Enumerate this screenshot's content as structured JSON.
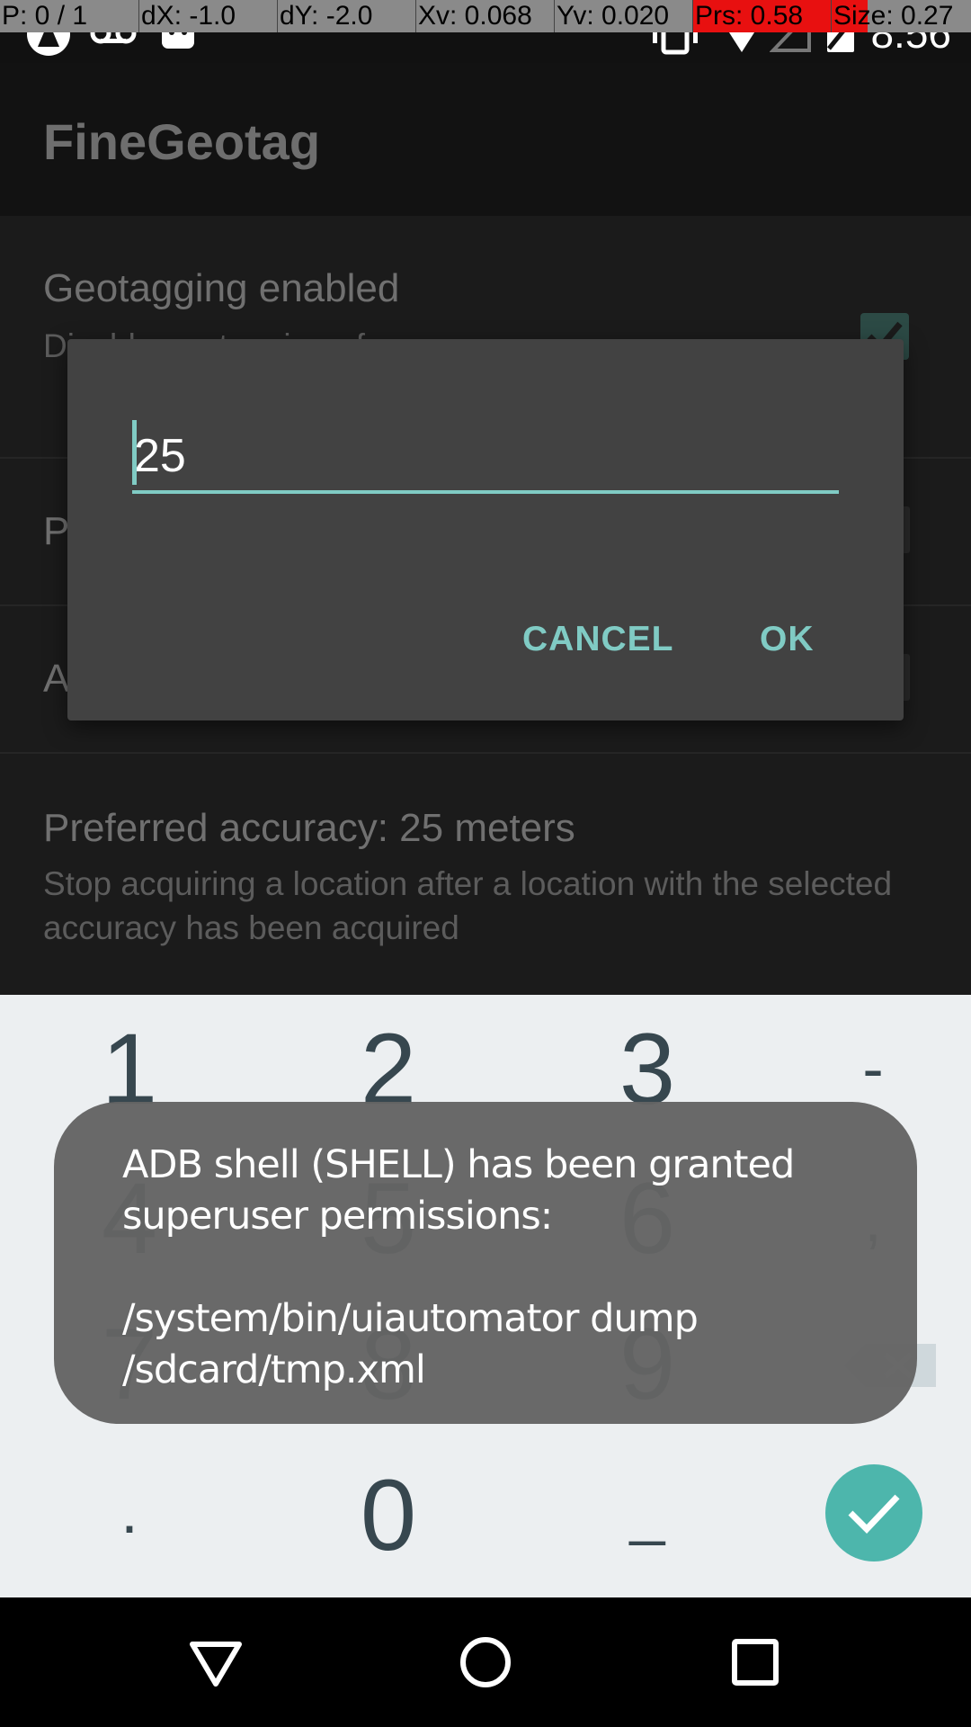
{
  "pointer_overlay": {
    "p": "P: 0 / 1",
    "dx": "dX: -1.0",
    "dy": "dY: -2.0",
    "xv": "Xv: 0.068",
    "yv": "Yv: 0.020",
    "prs": "Prs: 0.58",
    "size": "Size: 0.27"
  },
  "status_bar": {
    "time": "8:56",
    "icons": [
      "app-notification-icon",
      "voicemail-icon",
      "android-icon",
      "vibrate-icon",
      "wifi-icon",
      "signal-icon",
      "battery-icon"
    ]
  },
  "app": {
    "title": "FineGeotag",
    "prefs": [
      {
        "title": "Geotagging enabled",
        "summary": "Disable geotagging of your camera ap",
        "checked": true
      },
      {
        "title": "P"
      },
      {
        "title": "A"
      },
      {
        "title": "Preferred accuracy: 25 meters",
        "summary": "Stop acquiring a location after a location with the selected accuracy has been acquired"
      }
    ]
  },
  "dialog": {
    "input_value": "25",
    "cancel_label": "CANCEL",
    "ok_label": "OK",
    "accent_color": "#80cbc4"
  },
  "keyboard": {
    "row1": [
      "1",
      "2",
      "3",
      "-"
    ],
    "row2": [
      "4",
      "5",
      "6",
      ","
    ],
    "row3": [
      "7",
      "8",
      "9"
    ],
    "row4": [
      ".",
      "0",
      "_"
    ],
    "delete_icon": "backspace-icon",
    "done_icon": "check-icon",
    "done_color": "#4db6ac"
  },
  "toast": {
    "message": "ADB shell (SHELL) has been granted superuser permissions:\n\n/system/bin/uiautomator dump /sdcard/tmp.xml"
  },
  "nav_bar": {
    "back_icon": "back-triangle-icon",
    "home_icon": "home-circle-icon",
    "recents_icon": "recents-square-icon"
  }
}
